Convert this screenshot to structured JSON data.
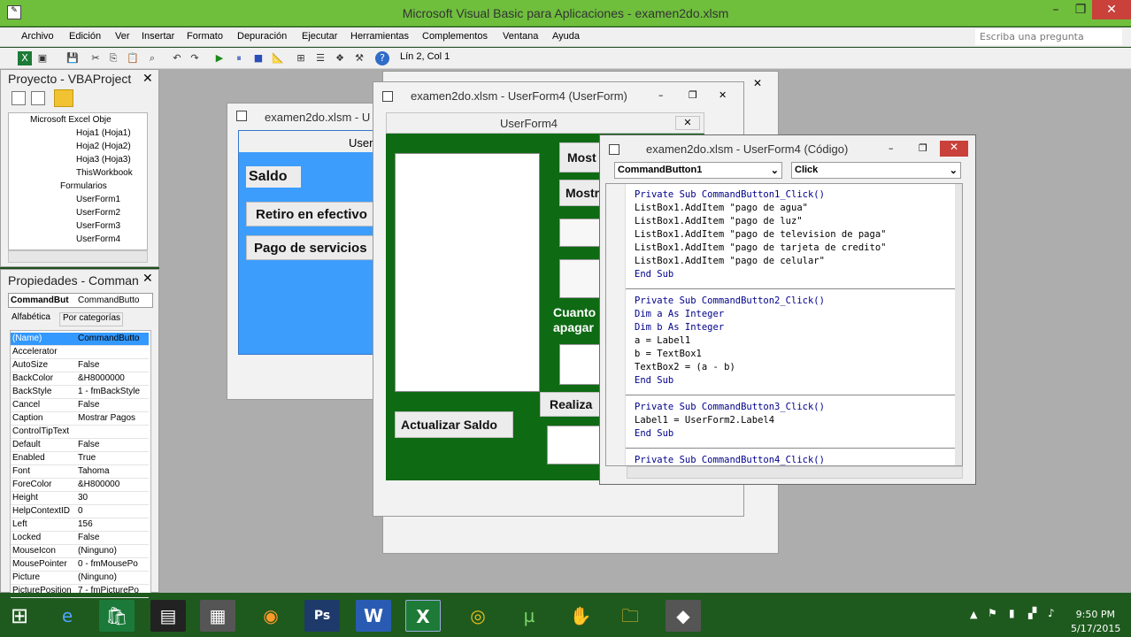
{
  "app": {
    "title": "Microsoft Visual Basic para Aplicaciones - examen2do.xlsm"
  },
  "menu": [
    "Archivo",
    "Edición",
    "Ver",
    "Insertar",
    "Formato",
    "Depuración",
    "Ejecutar",
    "Herramientas",
    "Complementos",
    "Ventana",
    "Ayuda"
  ],
  "ask_placeholder": "Escriba una pregunta",
  "toolbar": {
    "position": "Lín 2, Col 1"
  },
  "project": {
    "title": "Proyecto - VBAProject",
    "items": [
      "Microsoft Excel Obje",
      "Hoja1 (Hoja1)",
      "Hoja2 (Hoja2)",
      "Hoja3 (Hoja3)",
      "ThisWorkbook",
      "Formularios",
      "UserForm1",
      "UserForm2",
      "UserForm3",
      "UserForm4"
    ]
  },
  "properties": {
    "title": "Propiedades - Comman",
    "object_name": "CommandBut",
    "object_type": "CommandButto",
    "tabs": [
      "Alfabética",
      "Por categorías"
    ],
    "rows": [
      {
        "k": "(Name)",
        "v": "CommandButto"
      },
      {
        "k": "Accelerator",
        "v": ""
      },
      {
        "k": "AutoSize",
        "v": "False"
      },
      {
        "k": "BackColor",
        "v": "&H8000000"
      },
      {
        "k": "BackStyle",
        "v": "1 - fmBackStyle"
      },
      {
        "k": "Cancel",
        "v": "False"
      },
      {
        "k": "Caption",
        "v": "Mostrar Pagos"
      },
      {
        "k": "ControlTipText",
        "v": ""
      },
      {
        "k": "Default",
        "v": "False"
      },
      {
        "k": "Enabled",
        "v": "True"
      },
      {
        "k": "Font",
        "v": "Tahoma"
      },
      {
        "k": "ForeColor",
        "v": "&H800000"
      },
      {
        "k": "Height",
        "v": "30"
      },
      {
        "k": "HelpContextID",
        "v": "0"
      },
      {
        "k": "Left",
        "v": "156"
      },
      {
        "k": "Locked",
        "v": "False"
      },
      {
        "k": "MouseIcon",
        "v": "(Ninguno)"
      },
      {
        "k": "MousePointer",
        "v": "0 - fmMousePo"
      },
      {
        "k": "Picture",
        "v": "(Ninguno)"
      },
      {
        "k": "PicturePosition",
        "v": "7 - fmPicturePo"
      }
    ]
  },
  "form_back": {
    "title": "examen2do.xlsm - U",
    "form_caption": "User",
    "saldo": "Saldo",
    "retiro": "Retiro en efectivo",
    "pago": "Pago de servicios"
  },
  "form_mid": {
    "title": "examen2do.xlsm - UserForm4 (UserForm)",
    "caption": "UserForm4",
    "btn_mostrar1": "Most",
    "btn_mostrar2": "Mostr",
    "label_cuanto": "Cuanto",
    "label_apagar": "apagar",
    "btn_realiza": "Realiza",
    "btn_actualizar": "Actualizar Saldo"
  },
  "code_window": {
    "title": "examen2do.xlsm - UserForm4 (Código)",
    "object": "CommandButton1",
    "procedure": "Click",
    "lines": [
      "Private Sub CommandButton1_Click()",
      "ListBox1.AddItem \"pago de agua\"",
      "ListBox1.AddItem \"pago de luz\"",
      "ListBox1.AddItem \"pago de television de paga\"",
      "ListBox1.AddItem \"pago de tarjeta de credito\"",
      "ListBox1.AddItem \"pago de celular\"",
      "End Sub",
      "",
      "Private Sub CommandButton2_Click()",
      "Dim a As Integer",
      "Dim b As Integer",
      "a = Label1",
      "b = TextBox1",
      "TextBox2 = (a - b)",
      "End Sub",
      "",
      "Private Sub CommandButton3_Click()",
      "Label1 = UserForm2.Label4",
      "End Sub",
      "",
      "Private Sub CommandButton4_Click()"
    ]
  },
  "taskbar": {
    "time": "9:50 PM",
    "date": "5/17/2015"
  },
  "colors": {
    "titlebar": "#6fbf3d",
    "form_green": "#0f6a14",
    "form_blue": "#3d9dfd",
    "taskbar": "#1e5a1e"
  }
}
